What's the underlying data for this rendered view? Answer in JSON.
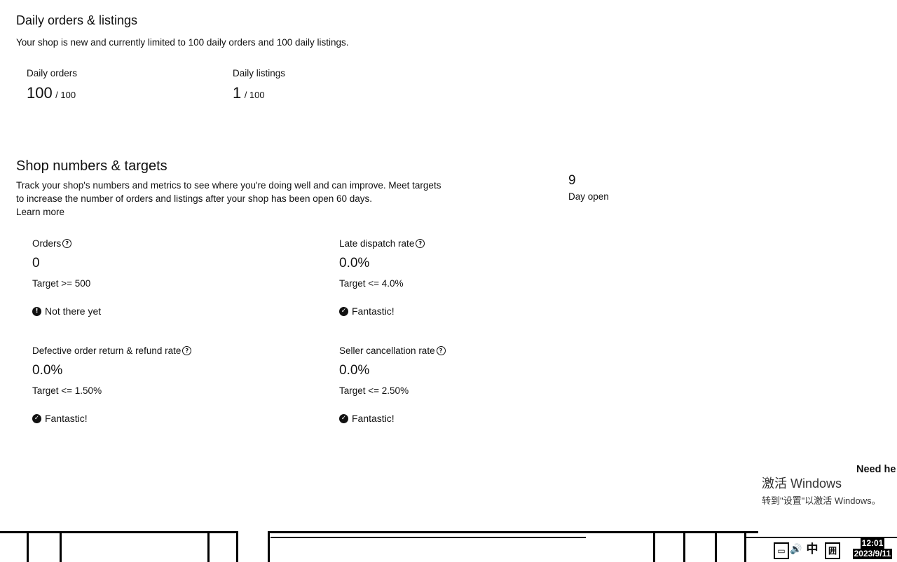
{
  "daily": {
    "title": "Daily orders & listings",
    "subtitle": "Your shop is new and currently limited to 100 daily orders and 100 daily listings.",
    "orders_label": "Daily orders",
    "orders_value": "100",
    "orders_limit": "/ 100",
    "listings_label": "Daily listings",
    "listings_value": "1",
    "listings_limit": "/ 100"
  },
  "shop": {
    "title": "Shop numbers & targets",
    "desc_line1": "Track your shop's numbers and metrics to see where you're doing well and can improve. Meet targets",
    "desc_line2": "to increase the number of orders and listings after your shop has been open 60 days.",
    "learn_more": "Learn more",
    "days_open_value": "9",
    "days_open_label": "Day open",
    "metrics": [
      {
        "title": "Orders",
        "value": "0",
        "target": "Target >= 500",
        "status": "Not there yet",
        "status_icon": "info-icon"
      },
      {
        "title": "Late dispatch rate",
        "value": "0.0%",
        "target": "Target <= 4.0%",
        "status": "Fantastic!",
        "status_icon": "check-circle-icon"
      },
      {
        "title": "Defective order return & refund rate",
        "value": "0.0%",
        "target": "Target <= 1.50%",
        "status": "Fantastic!",
        "status_icon": "check-circle-icon"
      },
      {
        "title": "Seller cancellation rate",
        "value": "0.0%",
        "target": "Target <= 2.50%",
        "status": "Fantastic!",
        "status_icon": "check-circle-icon"
      }
    ]
  },
  "need_help": "Need he",
  "activation": {
    "title": "激活 Windows",
    "subtitle": "转到\"设置\"以激活 Windows。"
  },
  "taskbar": {
    "tray_lang": "中",
    "tray_ime": "囲",
    "clock_time": "12:01",
    "clock_date": "2023/9/11"
  }
}
